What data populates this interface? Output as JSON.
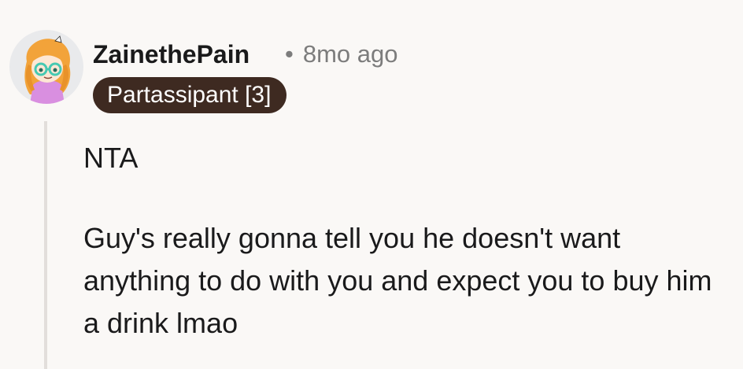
{
  "comment": {
    "author": "ZainethePain",
    "separator": "•",
    "age": "8mo ago",
    "flair": "Partassipant [3]",
    "paragraphs": [
      "NTA",
      "Guy's really gonna tell you he doesn't want anything to do with you and expect you to buy him a drink lmao"
    ]
  },
  "avatar": {
    "icon": "cartoon-user-avatar-icon",
    "colors": {
      "background": "#e9eaec",
      "hair": "#f2a33a",
      "shirt": "#d98fe0",
      "glasses": "#46c9b2"
    }
  },
  "colors": {
    "flair_bg": "#3e2a21",
    "meta_text": "#7c7c7c",
    "thread_line": "#e2dedb"
  }
}
